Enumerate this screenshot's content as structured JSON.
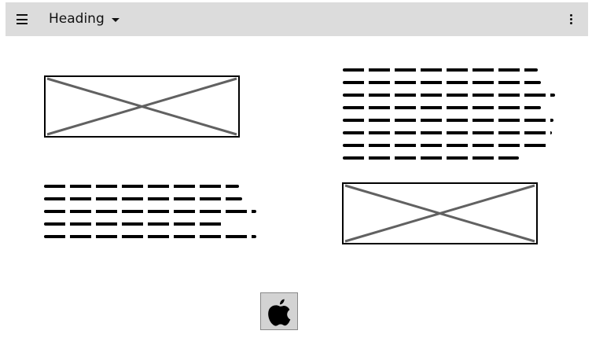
{
  "appbar": {
    "title": "Heading",
    "menu_icon": "hamburger-menu-icon",
    "dropdown_icon": "caret-down-icon",
    "overflow_icon": "vertical-dots-icon"
  },
  "content": {
    "image_placeholder_icon": "crossed-box-icon",
    "text_scribble_icon": "scribble-text-icon"
  },
  "footer": {
    "logo_icon": "apple-icon"
  },
  "colors": {
    "appbar_bg": "#dcdcdc",
    "ink": "#000000",
    "placeholder_cross": "#616161"
  }
}
